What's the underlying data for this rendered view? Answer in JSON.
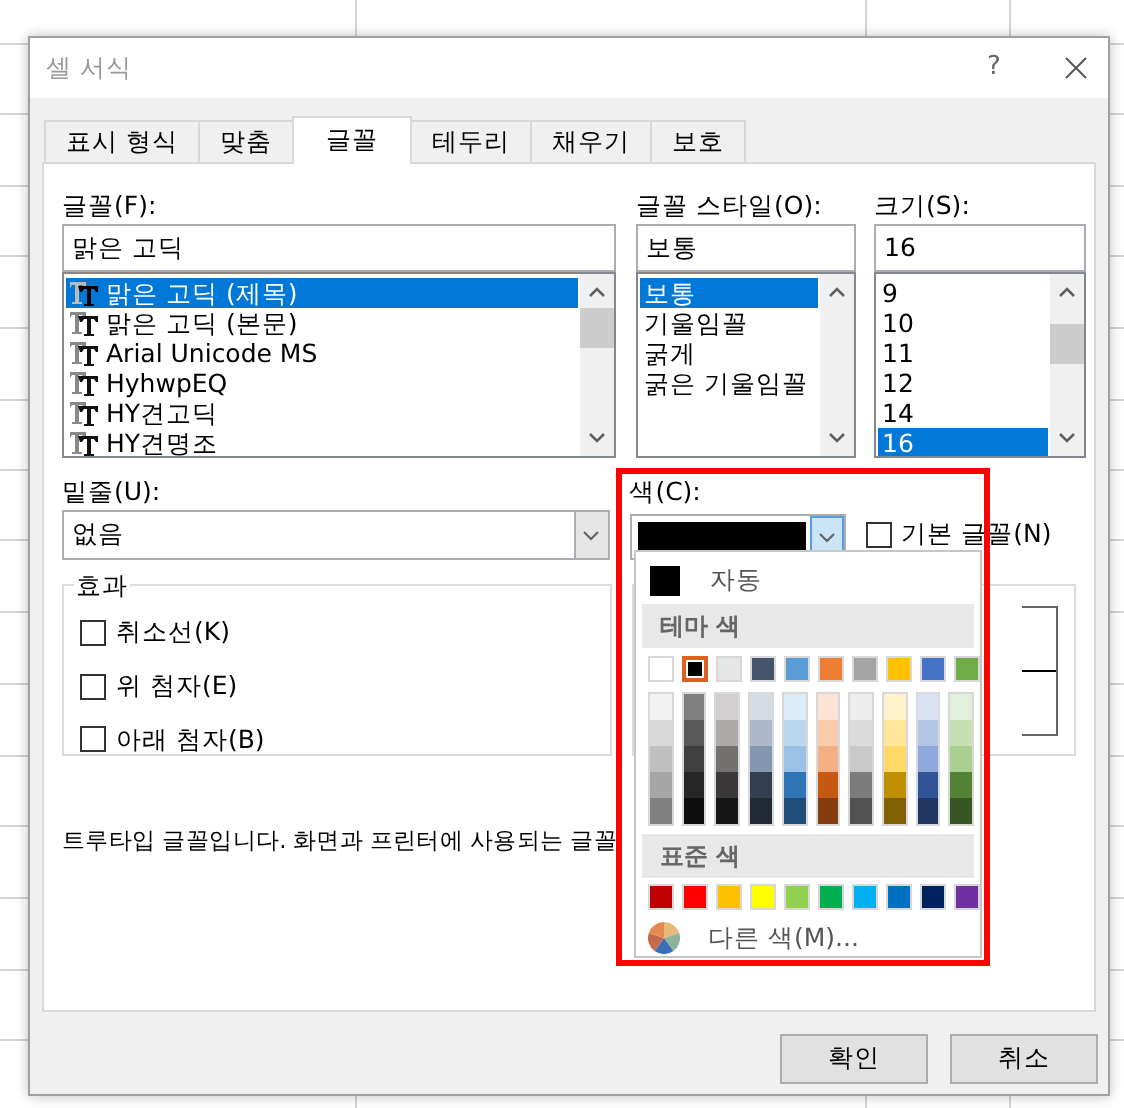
{
  "window": {
    "title": "셀 서식",
    "help": "?"
  },
  "tabs": [
    {
      "label": "표시 형식",
      "selected": false
    },
    {
      "label": "맞춤",
      "selected": false
    },
    {
      "label": "글꼴",
      "selected": true
    },
    {
      "label": "테두리",
      "selected": false
    },
    {
      "label": "채우기",
      "selected": false
    },
    {
      "label": "보호",
      "selected": false
    }
  ],
  "font": {
    "label": "글꼴(F):",
    "value": "맑은 고딕",
    "items": [
      {
        "label": "맑은 고딕 (제목)",
        "selected": true
      },
      {
        "label": "맑은 고딕 (본문)",
        "selected": false
      },
      {
        "label": "Arial Unicode MS",
        "selected": false
      },
      {
        "label": "HyhwpEQ",
        "selected": false
      },
      {
        "label": "HY견고딕",
        "selected": false
      },
      {
        "label": "HY견명조",
        "selected": false
      }
    ]
  },
  "font_style": {
    "label": "글꼴 스타일(O):",
    "value": "보통",
    "items": [
      {
        "label": "보통",
        "selected": true
      },
      {
        "label": "기울임꼴",
        "selected": false
      },
      {
        "label": "굵게",
        "selected": false
      },
      {
        "label": "굵은 기울임꼴",
        "selected": false
      }
    ]
  },
  "size": {
    "label": "크기(S):",
    "value": "16",
    "items": [
      {
        "label": "9",
        "selected": false
      },
      {
        "label": "10",
        "selected": false
      },
      {
        "label": "11",
        "selected": false
      },
      {
        "label": "12",
        "selected": false
      },
      {
        "label": "14",
        "selected": false
      },
      {
        "label": "16",
        "selected": true
      }
    ]
  },
  "underline": {
    "label": "밑줄(U):",
    "value": "없음"
  },
  "color": {
    "label": "색(C):",
    "current": {
      "color": "#000000"
    },
    "normal_font": {
      "label": "기본 글꼴(N)",
      "checked": false
    }
  },
  "effects": {
    "title": "효과",
    "items": [
      {
        "label": "취소선(K)",
        "checked": false
      },
      {
        "label": "위 첨자(E)",
        "checked": false
      },
      {
        "label": "아래 첨자(B)",
        "checked": false
      }
    ]
  },
  "description": "트루타입 글꼴입니다. 화면과 프린터에 사용되는 글꼴",
  "color_popup": {
    "automatic": {
      "label": "자동",
      "color": "#000000"
    },
    "theme_title": "테마 색",
    "theme_colors": [
      {
        "color": "#ffffff",
        "selected": false,
        "shades": [
          {
            "color": "#f2f2f2"
          },
          {
            "color": "#d9d9d9"
          },
          {
            "color": "#bfbfbf"
          },
          {
            "color": "#a6a6a6"
          },
          {
            "color": "#808080"
          }
        ]
      },
      {
        "color": "#000000",
        "selected": true,
        "shades": [
          {
            "color": "#808080"
          },
          {
            "color": "#595959"
          },
          {
            "color": "#404040"
          },
          {
            "color": "#262626"
          },
          {
            "color": "#0d0d0d"
          }
        ]
      },
      {
        "color": "#e7e6e6",
        "selected": false,
        "shades": [
          {
            "color": "#d0cece"
          },
          {
            "color": "#aeaaaa"
          },
          {
            "color": "#757171"
          },
          {
            "color": "#3a3838"
          },
          {
            "color": "#171616"
          }
        ]
      },
      {
        "color": "#44546a",
        "selected": false,
        "shades": [
          {
            "color": "#d6dce4"
          },
          {
            "color": "#adb9ca"
          },
          {
            "color": "#8497b0"
          },
          {
            "color": "#333f4f"
          },
          {
            "color": "#222b35"
          }
        ]
      },
      {
        "color": "#5b9bd5",
        "selected": false,
        "shades": [
          {
            "color": "#ddebf7"
          },
          {
            "color": "#bdd7ee"
          },
          {
            "color": "#9bc2e6"
          },
          {
            "color": "#2f75b5"
          },
          {
            "color": "#1f4e78"
          }
        ]
      },
      {
        "color": "#ed7d31",
        "selected": false,
        "shades": [
          {
            "color": "#fce4d6"
          },
          {
            "color": "#f8cbad"
          },
          {
            "color": "#f4b084"
          },
          {
            "color": "#c65911"
          },
          {
            "color": "#833c0c"
          }
        ]
      },
      {
        "color": "#a5a5a5",
        "selected": false,
        "shades": [
          {
            "color": "#ededed"
          },
          {
            "color": "#dbdbdb"
          },
          {
            "color": "#c9c9c9"
          },
          {
            "color": "#7b7b7b"
          },
          {
            "color": "#525252"
          }
        ]
      },
      {
        "color": "#ffc000",
        "selected": false,
        "shades": [
          {
            "color": "#fff2cc"
          },
          {
            "color": "#ffe699"
          },
          {
            "color": "#ffd966"
          },
          {
            "color": "#bf8f00"
          },
          {
            "color": "#806000"
          }
        ]
      },
      {
        "color": "#4472c4",
        "selected": false,
        "shades": [
          {
            "color": "#d9e1f2"
          },
          {
            "color": "#b4c6e7"
          },
          {
            "color": "#8ea9db"
          },
          {
            "color": "#305496"
          },
          {
            "color": "#203764"
          }
        ]
      },
      {
        "color": "#70ad47",
        "selected": false,
        "shades": [
          {
            "color": "#e2efda"
          },
          {
            "color": "#c6e0b4"
          },
          {
            "color": "#a9d08e"
          },
          {
            "color": "#548235"
          },
          {
            "color": "#375623"
          }
        ]
      }
    ],
    "standard_title": "표준 색",
    "standard_colors": [
      {
        "color": "#c00000"
      },
      {
        "color": "#ff0000"
      },
      {
        "color": "#ffc000"
      },
      {
        "color": "#ffff00"
      },
      {
        "color": "#92d050"
      },
      {
        "color": "#00b050"
      },
      {
        "color": "#00b0f0"
      },
      {
        "color": "#0070c0"
      },
      {
        "color": "#002060"
      },
      {
        "color": "#7030a0"
      }
    ],
    "more": "다른 색(M)..."
  },
  "buttons": [
    {
      "label": "확인"
    },
    {
      "label": "취소"
    }
  ]
}
